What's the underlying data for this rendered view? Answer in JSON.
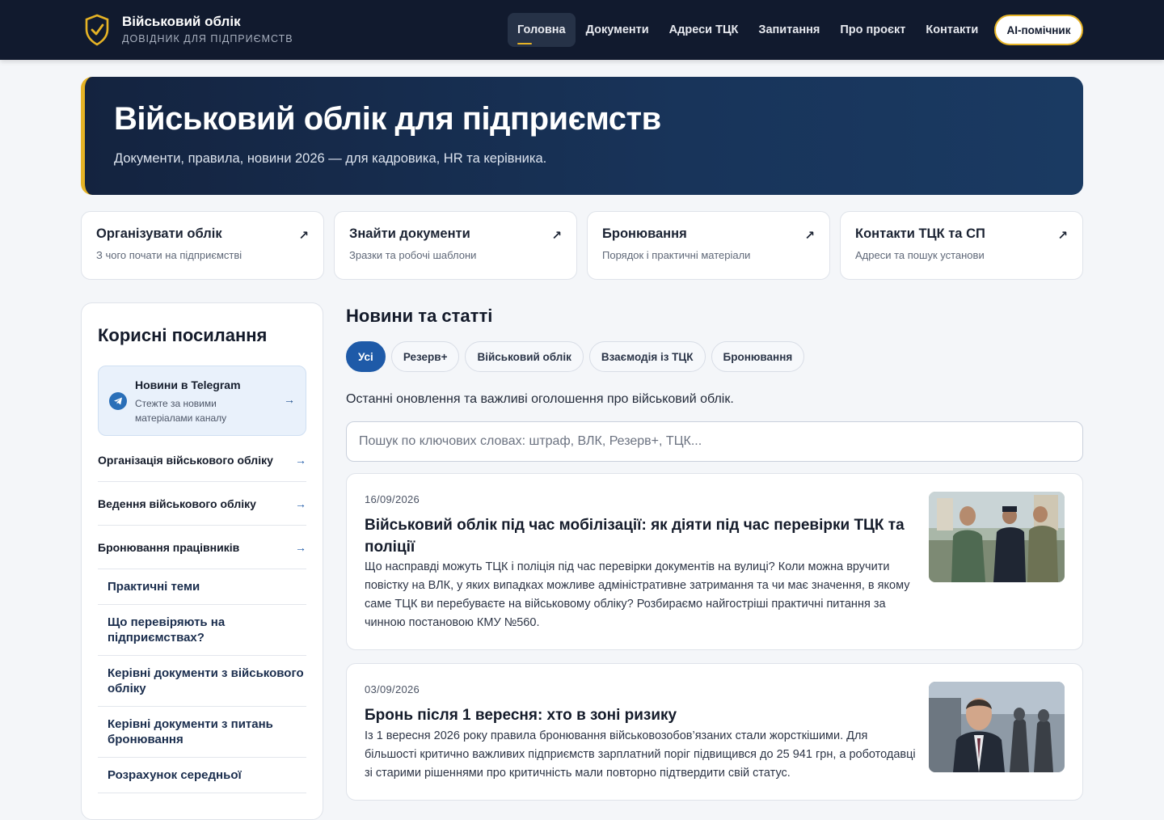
{
  "header": {
    "brand_title": "Військовий облік",
    "brand_subtitle": "ДОВІДНИК ДЛЯ ПІДПРИЄМСТВ",
    "nav": [
      {
        "label": "Головна",
        "active": true
      },
      {
        "label": "Документи"
      },
      {
        "label": "Адреси ТЦК"
      },
      {
        "label": "Запитання"
      },
      {
        "label": "Про проєкт"
      },
      {
        "label": "Контакти"
      }
    ],
    "ai_button": "AI-помічник"
  },
  "hero": {
    "title": "Військовий облік для підприємств",
    "subtitle": "Документи, правила, новини 2026 — для кадровика, HR та керівника."
  },
  "quick_cards": [
    {
      "title": "Організувати облік",
      "subtitle": "З чого почати на підприємстві"
    },
    {
      "title": "Знайти документи",
      "subtitle": "Зразки та робочі шаблони"
    },
    {
      "title": "Бронювання",
      "subtitle": "Порядок і практичні матеріали"
    },
    {
      "title": "Контакти ТЦК та СП",
      "subtitle": "Адреси та пошук установи"
    }
  ],
  "sidebar": {
    "title": "Корисні посилання",
    "telegram": {
      "title": "Новини в Telegram",
      "subtitle": "Стежте за новими матеріалами каналу"
    },
    "links": [
      "Організація військового обліку",
      "Ведення військового обліку",
      "Бронювання працівників"
    ],
    "sublinks": [
      "Практичні теми",
      "Що перевіряють на підприємствах?",
      "Керівні документи з військового обліку",
      "Керівні документи з питань бронювання",
      "Розрахунок середньої"
    ]
  },
  "news": {
    "title": "Новини та статті",
    "filters": [
      {
        "label": "Усі",
        "active": true
      },
      {
        "label": "Резерв+"
      },
      {
        "label": "Військовий облік"
      },
      {
        "label": "Взаємодія із ТЦК"
      },
      {
        "label": "Бронювання"
      }
    ],
    "description": "Останні оновлення та важливі оголошення про військовий облік.",
    "search_placeholder": "Пошук по ключових словах: штраф, ВЛК, Резерв+, ТЦК...",
    "search_value": "",
    "articles": [
      {
        "date": "16/09/2026",
        "title": "Військовий облік під час мобілізації: як діяти під час перевірки ТЦК та поліції",
        "text": "Що насправді можуть ТЦК і поліція під час перевірки документів на вулиці? Коли можна вручити повістку на ВЛК, у яких випадках можливе адміністративне затримання та чи має значення, в якому саме ТЦК ви перебуваєте на військовому обліку? Розбираємо найгостріші практичні питання за чинною постановою КМУ №560."
      },
      {
        "date": "03/09/2026",
        "title": "Бронь після 1 вересня: хто в зоні ризику",
        "text": "Із 1 вересня 2026 року правила бронювання військовозобов’язаних стали жорсткішими. Для більшості критично важливих підприємств зарплатний поріг підвищився до 25 941 грн, а роботодавці зі старими рішеннями про критичність мали повторно підтвердити свій статус."
      }
    ]
  },
  "colors": {
    "header_bg": "#111a2e",
    "accent_gold": "#e6b325",
    "primary_blue": "#1e5aa8"
  }
}
